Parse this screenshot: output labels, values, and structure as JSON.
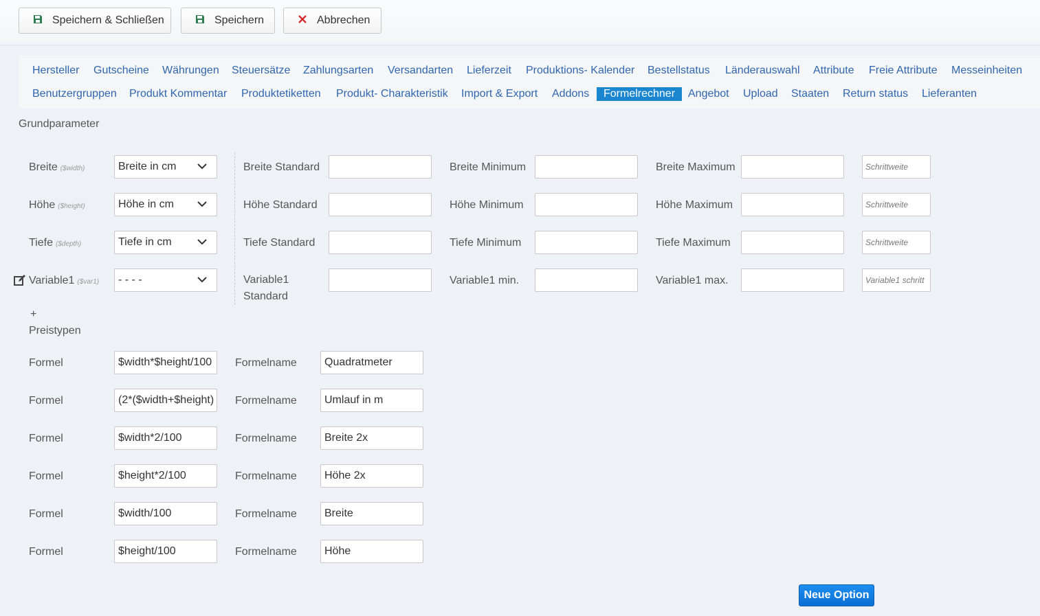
{
  "toolbar": {
    "save_close": "Speichern & Schließen",
    "save": "Speichern",
    "cancel": "Abbrechen"
  },
  "nav": {
    "row1": [
      "Hersteller",
      "Gutscheine",
      "Währungen",
      "Steuersätze",
      "Zahlungsarten",
      "Versandarten",
      "Lieferzeit",
      "Produktions- Kalender",
      "Bestellstatus",
      "Länderauswahl",
      "Attribute",
      "Freie Attribute",
      "Messeinheiten"
    ],
    "row2": [
      "Benutzergruppen",
      "Produkt Kommentar",
      "Produktetiketten",
      "Produkt- Charakteristik",
      "Import & Export",
      "Addons",
      "Formelrechner",
      "Angebot",
      "Upload",
      "Staaten",
      "Return status",
      "Lieferanten"
    ],
    "active": "Formelrechner"
  },
  "section_title": "Grundparameter",
  "params": [
    {
      "label": "Breite",
      "var": "($width)",
      "select": "Breite in cm",
      "std_label": "Breite Standard",
      "std_value": "",
      "min_label": "Breite Minimum",
      "min_value": "",
      "max_label": "Breite Maximum",
      "max_value": "",
      "step_placeholder": "Schrittweite"
    },
    {
      "label": "Höhe",
      "var": "($height)",
      "select": "Höhe in cm",
      "std_label": "Höhe Standard",
      "std_value": "",
      "min_label": "Höhe Minimum",
      "min_value": "",
      "max_label": "Höhe Maximum",
      "max_value": "",
      "step_placeholder": "Schrittweite"
    },
    {
      "label": "Tiefe",
      "var": "($depth)",
      "select": "Tiefe in cm",
      "std_label": "Tiefe Standard",
      "std_value": "",
      "min_label": "Tiefe Minimum",
      "min_value": "",
      "max_label": "Tiefe Maximum",
      "max_value": "",
      "step_placeholder": "Schrittweite"
    },
    {
      "label": "Variable1",
      "var": "($var1)",
      "select": "- - - -",
      "std_label_line1": "Variable1",
      "std_label_line2": "Standard",
      "std_value": "",
      "min_label": "Variable1 min.",
      "min_value": "",
      "max_label": "Variable1 max.",
      "max_value": "",
      "step_placeholder": "Variable1 schritt"
    }
  ],
  "add_symbol": "+",
  "price_types_label": "Preistypen",
  "formulas": [
    {
      "label": "Formel",
      "value": "$width*$height/100",
      "name_label": "Formelname",
      "name": "Quadratmeter"
    },
    {
      "label": "Formel",
      "value": "(2*($width+$height)",
      "name_label": "Formelname",
      "name": "Umlauf in m"
    },
    {
      "label": "Formel",
      "value": "$width*2/100",
      "name_label": "Formelname",
      "name": "Breite 2x"
    },
    {
      "label": "Formel",
      "value": "$height*2/100",
      "name_label": "Formelname",
      "name": "Höhe 2x"
    },
    {
      "label": "Formel",
      "value": "$width/100",
      "name_label": "Formelname",
      "name": "Breite"
    },
    {
      "label": "Formel",
      "value": "$height/100",
      "name_label": "Formelname",
      "name": "Höhe"
    }
  ],
  "new_option": "Neue Option",
  "icons": {
    "save": "floppy-disk-icon",
    "cancel": "x-icon",
    "edit": "edit-icon",
    "chevron": "chevron-down-icon"
  },
  "colors": {
    "link": "#3066b0",
    "active_tab": "#1a86d0",
    "cancel_icon": "#d32f2f",
    "save_icon": "#2e7d4f",
    "primary_button": "#0a6fd3"
  }
}
